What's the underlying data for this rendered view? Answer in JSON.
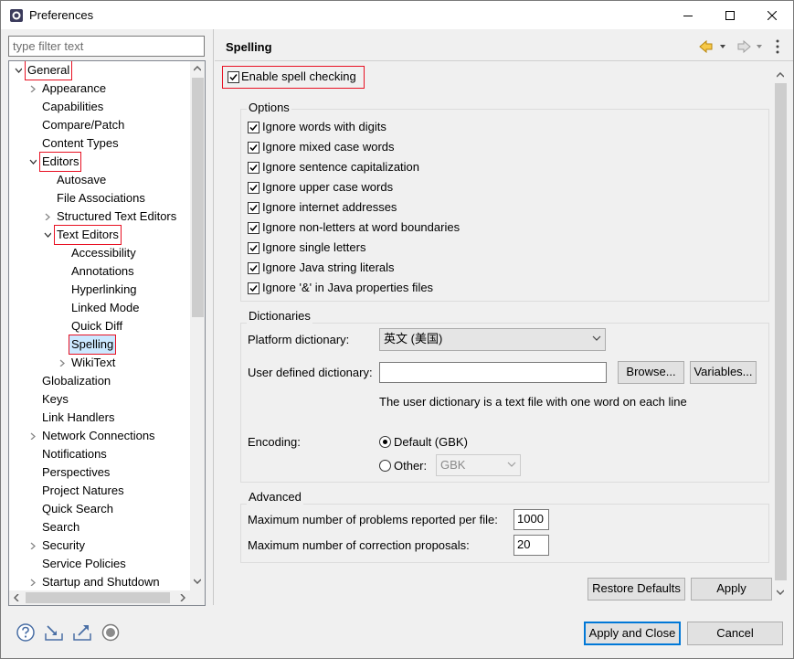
{
  "window": {
    "title": "Preferences"
  },
  "filter": {
    "placeholder": "type filter text"
  },
  "tree": {
    "items": [
      {
        "label": "General",
        "level": 0,
        "expanded": true,
        "highlighted": true
      },
      {
        "label": "Appearance",
        "level": 1,
        "collapsed": true
      },
      {
        "label": "Capabilities",
        "level": 1
      },
      {
        "label": "Compare/Patch",
        "level": 1
      },
      {
        "label": "Content Types",
        "level": 1
      },
      {
        "label": "Editors",
        "level": 1,
        "expanded": true,
        "highlighted": true
      },
      {
        "label": "Autosave",
        "level": 2
      },
      {
        "label": "File Associations",
        "level": 2
      },
      {
        "label": "Structured Text Editors",
        "level": 2,
        "collapsed": true
      },
      {
        "label": "Text Editors",
        "level": 2,
        "expanded": true,
        "highlighted": true
      },
      {
        "label": "Accessibility",
        "level": 3
      },
      {
        "label": "Annotations",
        "level": 3
      },
      {
        "label": "Hyperlinking",
        "level": 3
      },
      {
        "label": "Linked Mode",
        "level": 3
      },
      {
        "label": "Quick Diff",
        "level": 3
      },
      {
        "label": "Spelling",
        "level": 3,
        "selected": true,
        "highlighted": true
      },
      {
        "label": "WikiText",
        "level": 3,
        "collapsed": true
      },
      {
        "label": "Globalization",
        "level": 1
      },
      {
        "label": "Keys",
        "level": 1
      },
      {
        "label": "Link Handlers",
        "level": 1
      },
      {
        "label": "Network Connections",
        "level": 1,
        "collapsed": true
      },
      {
        "label": "Notifications",
        "level": 1
      },
      {
        "label": "Perspectives",
        "level": 1
      },
      {
        "label": "Project Natures",
        "level": 1
      },
      {
        "label": "Quick Search",
        "level": 1
      },
      {
        "label": "Search",
        "level": 1
      },
      {
        "label": "Security",
        "level": 1,
        "collapsed": true
      },
      {
        "label": "Service Policies",
        "level": 1
      },
      {
        "label": "Startup and Shutdown",
        "level": 1,
        "collapsed": true
      }
    ]
  },
  "page": {
    "title": "Spelling",
    "enable_label": "Enable spell checking",
    "options_title": "Options",
    "options": [
      "Ignore words with digits",
      "Ignore mixed case words",
      "Ignore sentence capitalization",
      "Ignore upper case words",
      "Ignore internet addresses",
      "Ignore non-letters at word boundaries",
      "Ignore single letters",
      "Ignore Java string literals",
      "Ignore '&' in Java properties files"
    ],
    "dictionaries_title": "Dictionaries",
    "platform_dict_label": "Platform dictionary:",
    "platform_dict_value": "英文 (美国)",
    "user_dict_label": "User defined dictionary:",
    "user_dict_value": "",
    "browse_label": "Browse...",
    "variables_label": "Variables...",
    "user_dict_hint": "The user dictionary is a text file with one word on each line",
    "encoding_label": "Encoding:",
    "encoding_default_label": "Default (GBK)",
    "encoding_other_label": "Other:",
    "encoding_other_value": "GBK",
    "advanced_title": "Advanced",
    "max_problems_label": "Maximum number of problems reported per file:",
    "max_problems_value": "1000",
    "max_proposals_label": "Maximum number of correction proposals:",
    "max_proposals_value": "20",
    "restore_defaults_label": "Restore Defaults",
    "apply_label": "Apply"
  },
  "footer": {
    "apply_close_label": "Apply and Close",
    "cancel_label": "Cancel",
    "icons": [
      "help-icon",
      "import-icon",
      "export-icon",
      "record-icon"
    ]
  },
  "colors": {
    "selection": "#cce8ff",
    "highlight_box": "#e81123",
    "default_button": "#0078d7"
  }
}
